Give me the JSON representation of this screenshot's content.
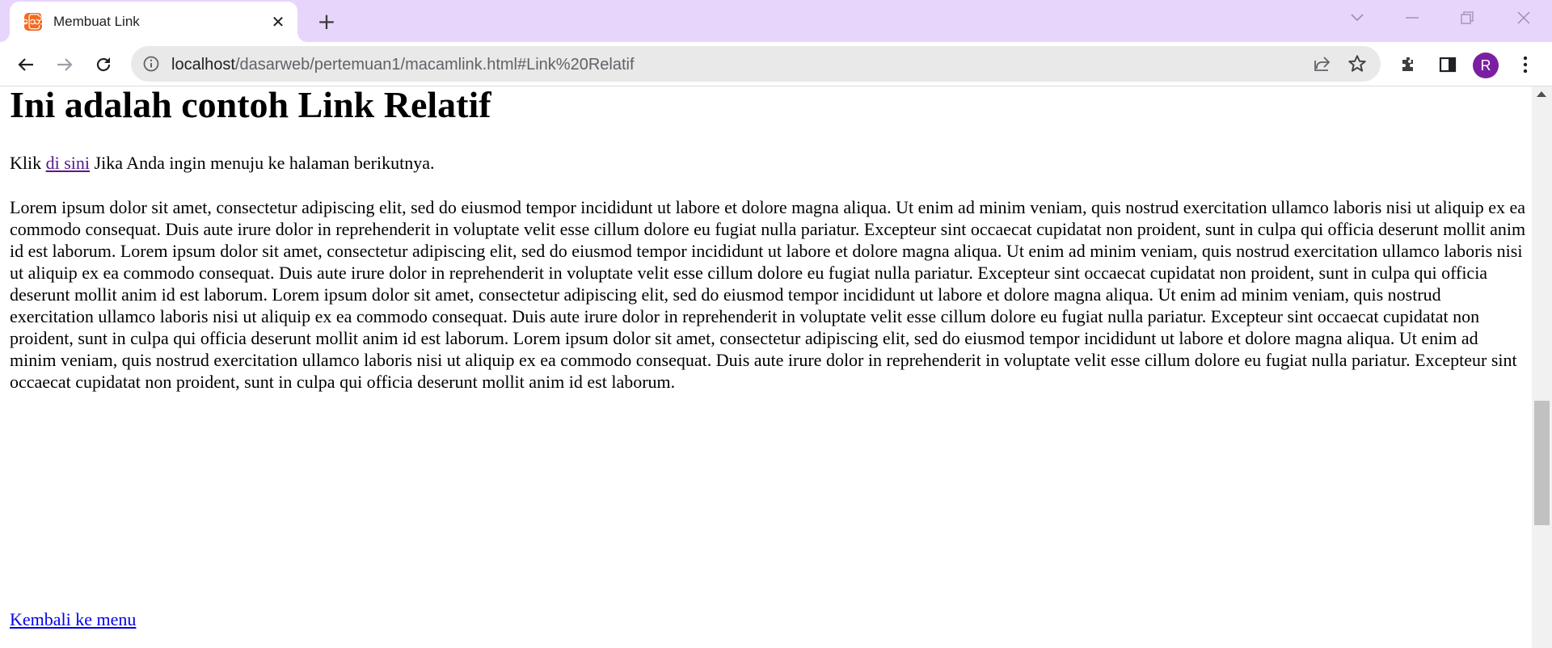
{
  "tab": {
    "title": "Membuat Link",
    "favicon_letter": "ဪ",
    "close": "✕",
    "new_tab": "+"
  },
  "window": {
    "search": "⌄",
    "minimize": "—",
    "restore": "❐",
    "close": "✕"
  },
  "toolbar": {
    "url_host": "localhost",
    "url_path": "/dasarweb/pertemuan1/macamlink.html#Link%20Relatif",
    "avatar_letter": "R"
  },
  "page": {
    "heading": "Ini adalah contoh Link Relatif",
    "intro_before": "Klik ",
    "intro_link": "di sini",
    "intro_after": " Jika Anda ingin menuju ke halaman berikutnya.",
    "lorem": "Lorem ipsum dolor sit amet, consectetur adipiscing elit, sed do eiusmod tempor incididunt ut labore et dolore magna aliqua. Ut enim ad minim veniam, quis nostrud exercitation ullamco laboris nisi ut aliquip ex ea commodo consequat. Duis aute irure dolor in reprehenderit in voluptate velit esse cillum dolore eu fugiat nulla pariatur. Excepteur sint occaecat cupidatat non proident, sunt in culpa qui officia deserunt mollit anim id est laborum. Lorem ipsum dolor sit amet, consectetur adipiscing elit, sed do eiusmod tempor incididunt ut labore et dolore magna aliqua. Ut enim ad minim veniam, quis nostrud exercitation ullamco laboris nisi ut aliquip ex ea commodo consequat. Duis aute irure dolor in reprehenderit in voluptate velit esse cillum dolore eu fugiat nulla pariatur. Excepteur sint occaecat cupidatat non proident, sunt in culpa qui officia deserunt mollit anim id est laborum. Lorem ipsum dolor sit amet, consectetur adipiscing elit, sed do eiusmod tempor incididunt ut labore et dolore magna aliqua. Ut enim ad minim veniam, quis nostrud exercitation ullamco laboris nisi ut aliquip ex ea commodo consequat. Duis aute irure dolor in reprehenderit in voluptate velit esse cillum dolore eu fugiat nulla pariatur. Excepteur sint occaecat cupidatat non proident, sunt in culpa qui officia deserunt mollit anim id est laborum. Lorem ipsum dolor sit amet, consectetur adipiscing elit, sed do eiusmod tempor incididunt ut labore et dolore magna aliqua. Ut enim ad minim veniam, quis nostrud exercitation ullamco laboris nisi ut aliquip ex ea commodo consequat. Duis aute irure dolor in reprehenderit in voluptate velit esse cillum dolore eu fugiat nulla pariatur. Excepteur sint occaecat cupidatat non proident, sunt in culpa qui officia deserunt mollit anim id est laborum.",
    "back_link": "Kembali ke menu"
  },
  "colors": {
    "tabstrip": "#e8d5fc",
    "avatar": "#7b1fa2",
    "favicon": "#f26b21",
    "visited_link": "#551a8b",
    "link": "#0000ee"
  },
  "icons": [
    "back-arrow-icon",
    "forward-arrow-icon",
    "reload-icon",
    "info-icon",
    "share-icon",
    "star-icon",
    "extensions-icon",
    "side-panel-icon",
    "more-menu-icon"
  ]
}
